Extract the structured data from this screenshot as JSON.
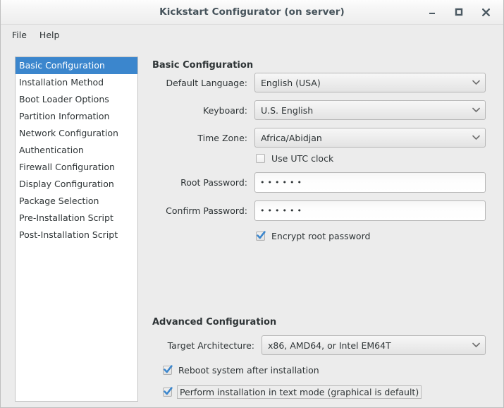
{
  "window": {
    "title": "Kickstart Configurator (on server)",
    "buttons": {
      "minimize": "minimize",
      "maximize": "maximize",
      "close": "close"
    }
  },
  "menubar": {
    "items": [
      {
        "label": "File"
      },
      {
        "label": "Help"
      }
    ]
  },
  "sidebar": {
    "items": [
      {
        "label": "Basic Configuration",
        "selected": true
      },
      {
        "label": "Installation Method",
        "selected": false
      },
      {
        "label": "Boot Loader Options",
        "selected": false
      },
      {
        "label": "Partition Information",
        "selected": false
      },
      {
        "label": "Network Configuration",
        "selected": false
      },
      {
        "label": "Authentication",
        "selected": false
      },
      {
        "label": "Firewall Configuration",
        "selected": false
      },
      {
        "label": "Display Configuration",
        "selected": false
      },
      {
        "label": "Package Selection",
        "selected": false
      },
      {
        "label": "Pre-Installation Script",
        "selected": false
      },
      {
        "label": "Post-Installation Script",
        "selected": false
      }
    ]
  },
  "basic_section": {
    "heading": "Basic Configuration",
    "default_language": {
      "label": "Default Language:",
      "value": "English (USA)"
    },
    "keyboard": {
      "label": "Keyboard:",
      "value": "U.S. English"
    },
    "time_zone": {
      "label": "Time Zone:",
      "value": "Africa/Abidjan"
    },
    "use_utc_clock": {
      "label": "Use UTC clock",
      "checked": false
    },
    "root_password": {
      "label": "Root Password:",
      "value": "••••••"
    },
    "confirm_password": {
      "label": "Confirm Password:",
      "value": "••••••"
    },
    "encrypt_root_password": {
      "label": "Encrypt root password",
      "checked": true
    }
  },
  "advanced_section": {
    "heading": "Advanced Configuration",
    "target_architecture": {
      "label": "Target Architecture:",
      "value": "x86, AMD64, or Intel EM64T"
    },
    "reboot_after_install": {
      "label": "Reboot system after installation",
      "checked": true
    },
    "text_mode_install": {
      "label": "Perform installation in text mode (graphical is default)",
      "checked": true,
      "focused": true
    }
  },
  "colors": {
    "selection_blue": "#3b86cd",
    "window_bg": "#ececec",
    "list_bg": "#ffffff",
    "text": "#2e3436",
    "title_text": "#45525a",
    "check_blue": "#3b86cd"
  }
}
